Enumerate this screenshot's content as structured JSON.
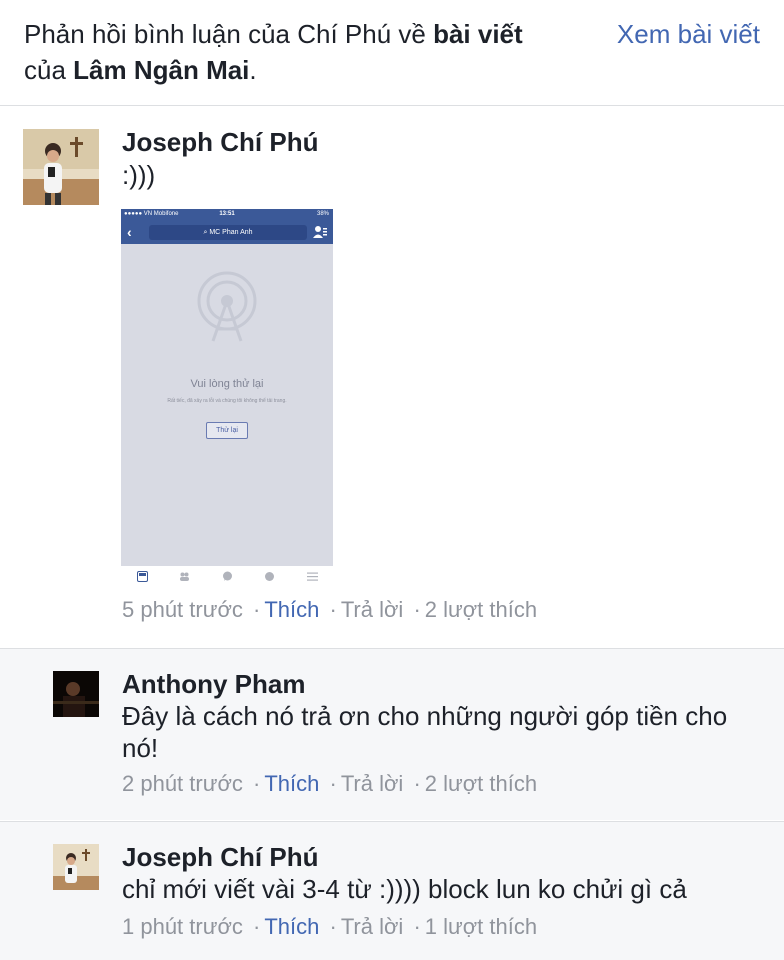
{
  "header": {
    "text_prefix": "Phản hồi bình luận của Chí Phú về ",
    "text_bold_1": "bài viết",
    "text_middle": "của ",
    "text_bold_2": "Lâm Ngân Mai",
    "text_suffix": ".",
    "view_post_link": "Xem bài viết"
  },
  "comments": [
    {
      "author": "Joseph Chí Phú",
      "text": ":)))",
      "time": "5 phút trước",
      "like_label": "Thích",
      "reply_label": "Trả lời",
      "like_count": "2 lượt thích",
      "separator": "·",
      "attachment": {
        "status_carrier": "●●●●● VN Mobifone",
        "status_time": "13:51",
        "status_battery": "38%",
        "search_text": "MC Phan Anh",
        "back_glyph": "‹",
        "error_title": "Vui lòng thử lại",
        "error_sub": "Rất tiếc, đã xảy ra lỗi và chúng tôi không thể tải trang.",
        "retry_button": "Thử lại"
      }
    },
    {
      "author": "Anthony Pham",
      "text": "Đây là cách nó trả ơn cho những người góp tiền cho nó!",
      "time": "2 phút trước",
      "like_label": "Thích",
      "reply_label": "Trả lời",
      "like_count": "2 lượt thích",
      "separator": "·"
    },
    {
      "author": "Joseph Chí Phú",
      "text": "chỉ mới viết vài 3-4 từ :)))) block lun ko chửi gì cả",
      "time": "1 phút trước",
      "like_label": "Thích",
      "reply_label": "Trả lời",
      "like_count": "1 lượt thích",
      "separator": "·"
    }
  ],
  "colors": {
    "link_blue": "#4267b2",
    "meta_gray": "#90949c",
    "reply_bg": "#f6f7f9",
    "fb_blue": "#3b5998"
  }
}
